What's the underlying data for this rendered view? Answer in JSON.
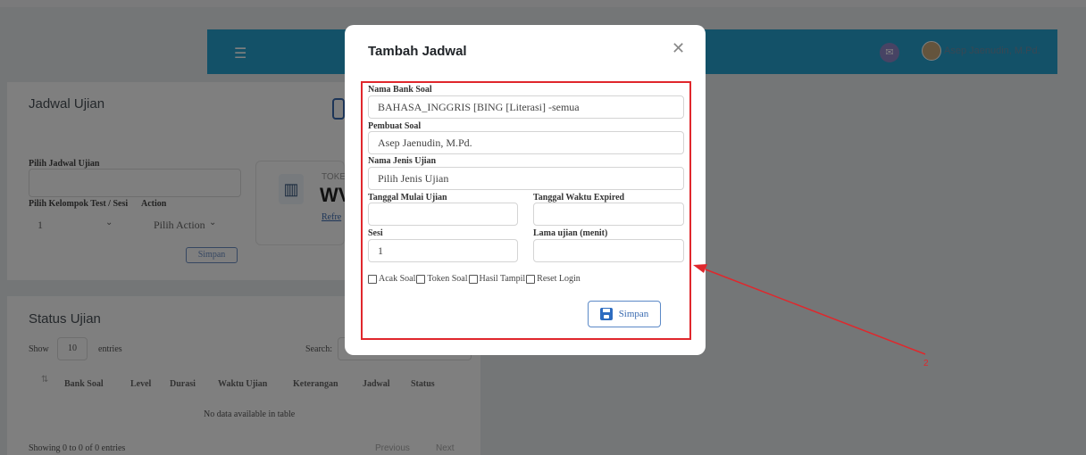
{
  "topbar": {
    "menu_icon": "hamburger-icon",
    "mail_icon": "envelope-icon",
    "user_name": "Asep Jaenudin, M.Pd."
  },
  "jadwal_card": {
    "title": "Jadwal Ujian",
    "pilih_jadwal_label": "Pilih Jadwal Ujian",
    "kelompok_label": "Pilih Kelompok Test / Sesi",
    "kelompok_value": "1",
    "action_label": "Action",
    "action_value": "Pilih Action",
    "simpan_label": "Simpan",
    "token_label": "TOKE",
    "token_value": "WV",
    "refresh_label": "Refre"
  },
  "status_card": {
    "title": "Status Ujian",
    "show_label": "Show",
    "entries_value": "10",
    "entries_label": "entries",
    "search_label": "Search:",
    "columns": [
      "Bank Soal",
      "Level",
      "Durasi",
      "Waktu Ujian",
      "Keterangan",
      "Jadwal",
      "Status"
    ],
    "empty_text": "No data available in table",
    "info_text": "Showing 0 to 0 of 0 entries",
    "prev_label": "Previous",
    "next_label": "Next"
  },
  "modal": {
    "title": "Tambah Jadwal",
    "close_icon": "close-icon",
    "nama_bank_soal_label": "Nama Bank Soal",
    "nama_bank_soal_value": "BAHASA_INGGRIS [BING [Literasi] -semua",
    "pembuat_soal_label": "Pembuat Soal",
    "pembuat_soal_value": "Asep Jaenudin, M.Pd.",
    "jenis_ujian_label": "Nama Jenis Ujian",
    "jenis_ujian_value": "Pilih Jenis Ujian",
    "tanggal_mulai_label": "Tanggal Mulai Ujian",
    "tanggal_mulai_value": "",
    "tanggal_expired_label": "Tanggal Waktu Expired",
    "tanggal_expired_value": "",
    "sesi_label": "Sesi",
    "sesi_value": "1",
    "lama_label": "Lama ujian (menit)",
    "lama_value": "",
    "checkboxes": [
      "Acak Soal",
      "Token Soal",
      "Hasil Tampil",
      "Reset Login"
    ],
    "save_label": "Simpan",
    "save_icon": "floppy-disk-icon"
  },
  "annotation": {
    "number": "2",
    "color": "#e0272c"
  }
}
